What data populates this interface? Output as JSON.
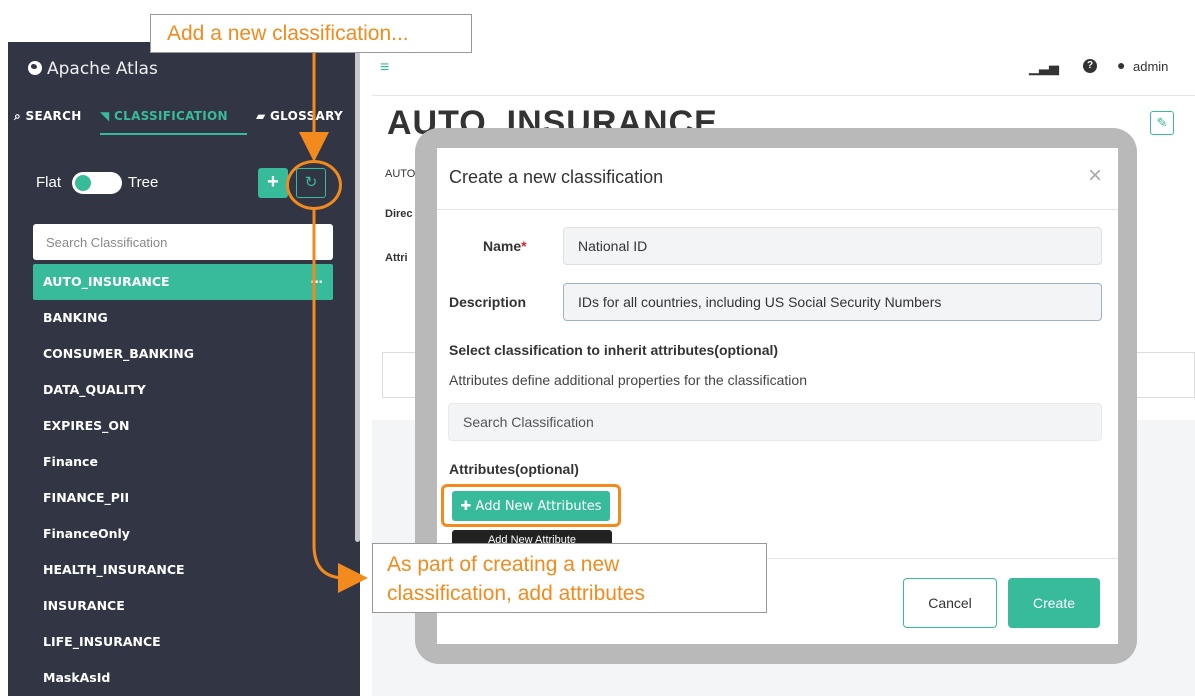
{
  "sidebar": {
    "brand": "Apache Atlas",
    "tabs": [
      {
        "label": "SEARCH",
        "icon": "search-icon"
      },
      {
        "label": "CLASSIFICATION",
        "icon": "tag-icon"
      },
      {
        "label": "GLOSSARY",
        "icon": "folder-icon"
      }
    ],
    "toggle": {
      "left_label": "Flat",
      "right_label": "Tree"
    },
    "search_placeholder": "Search Classification",
    "items": [
      "AUTO_INSURANCE",
      "BANKING",
      "CONSUMER_BANKING",
      "DATA_QUALITY",
      "EXPIRES_ON",
      "Finance",
      "FINANCE_PII",
      "FinanceOnly",
      "HEALTH_INSURANCE",
      "INSURANCE",
      "LIFE_INSURANCE",
      "MaskAsId"
    ],
    "active_item": "AUTO_INSURANCE"
  },
  "topbar": {
    "user": "admin"
  },
  "main": {
    "title": "AUTO_INSURANCE",
    "partial_labels": {
      "breadcrumb": "AUTO",
      "direct": "Direc",
      "attributes": "Attri"
    }
  },
  "modal": {
    "title": "Create a new classification",
    "name_label": "Name",
    "name_required": "*",
    "name_value": "National ID",
    "description_label": "Description",
    "description_value": "IDs for all countries, including US Social Security Numbers",
    "inherit_heading": "Select classification to inherit attributes(optional)",
    "inherit_help": "Attributes define additional properties for the classification",
    "inherit_placeholder": "Search Classification",
    "attributes_heading": "Attributes(optional)",
    "add_attributes_button": "Add New Attributes",
    "tooltip": "Add New Attribute",
    "cancel_button": "Cancel",
    "create_button": "Create"
  },
  "annotations": {
    "top": "Add a new classification...",
    "bottom_line1": "As part of creating a new",
    "bottom_line2": "classification, add attributes"
  },
  "colors": {
    "accent": "#38bb9b",
    "sidebar_bg": "#323544",
    "annotation": "#f28a1e"
  }
}
